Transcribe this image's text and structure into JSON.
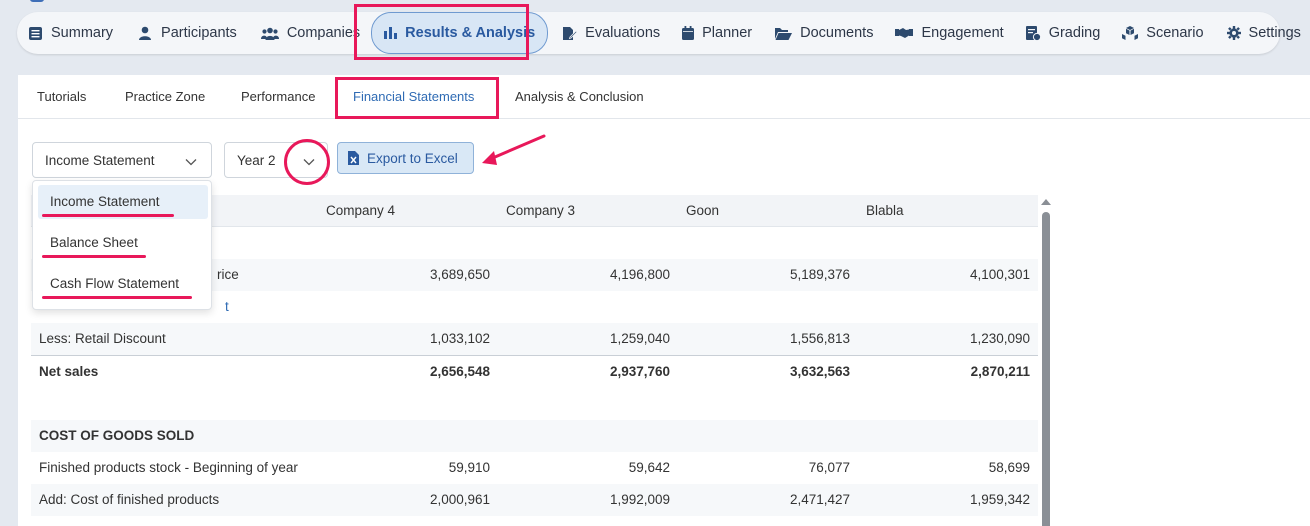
{
  "main_nav": {
    "items": [
      {
        "label": "Summary",
        "icon": "list-icon"
      },
      {
        "label": "Participants",
        "icon": "user-icon"
      },
      {
        "label": "Companies",
        "icon": "users-icon"
      },
      {
        "label": "Results & Analysis",
        "icon": "bar-chart-icon",
        "active": true
      },
      {
        "label": "Evaluations",
        "icon": "edit-document-icon"
      },
      {
        "label": "Planner",
        "icon": "calendar-icon"
      },
      {
        "label": "Documents",
        "icon": "folder-open-icon"
      },
      {
        "label": "Engagement",
        "icon": "handshake-icon"
      },
      {
        "label": "Grading",
        "icon": "grading-icon"
      },
      {
        "label": "Scenario",
        "icon": "cubes-icon"
      },
      {
        "label": "Settings",
        "icon": "gear-icon"
      }
    ]
  },
  "sub_tabs": [
    {
      "label": "Tutorials"
    },
    {
      "label": "Practice Zone"
    },
    {
      "label": "Performance"
    },
    {
      "label": "Financial Statements",
      "active": true
    },
    {
      "label": "Analysis & Conclusion"
    }
  ],
  "controls": {
    "statement_select": "Income Statement",
    "year_select": "Year 2",
    "export_label": "Export to Excel"
  },
  "dropdown": {
    "options": [
      "Income Statement",
      "Balance Sheet",
      "Cash Flow Statement"
    ],
    "selected": "Income Statement"
  },
  "table": {
    "headers": [
      "Company 4",
      "Company 3",
      "Goon",
      "Blabla"
    ],
    "rows": [
      {
        "label": "",
        "values": [
          "",
          "",
          "",
          ""
        ]
      },
      {
        "label": "rice",
        "values": [
          "3,689,650",
          "4,196,800",
          "5,189,376",
          "4,100,301"
        ]
      },
      {
        "label": "t",
        "values": [
          "",
          "",
          "",
          ""
        ]
      },
      {
        "label": "Less: Retail Discount",
        "values": [
          "1,033,102",
          "1,259,040",
          "1,556,813",
          "1,230,090"
        ]
      },
      {
        "label": "Net sales",
        "values": [
          "2,656,548",
          "2,937,760",
          "3,632,563",
          "2,870,211"
        ]
      },
      {
        "label": "",
        "values": [
          "",
          "",
          "",
          ""
        ]
      },
      {
        "label": "COST OF GOODS SOLD",
        "values": [
          "",
          "",
          "",
          ""
        ]
      },
      {
        "label": "Finished products stock - Beginning of year",
        "values": [
          "59,910",
          "59,642",
          "76,077",
          "58,699"
        ]
      },
      {
        "label": "Add: Cost of finished products",
        "values": [
          "2,000,961",
          "1,992,009",
          "2,471,427",
          "1,959,342"
        ]
      }
    ]
  },
  "colors": {
    "highlight": "#e8185a",
    "accent": "#2f6bb4",
    "active_nav_bg": "#d8e6f5"
  }
}
